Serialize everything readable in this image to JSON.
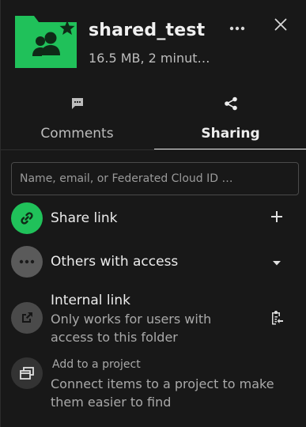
{
  "header": {
    "title": "shared_test",
    "subtitle": "16.5 MB, 2 minut…",
    "folder_icon": "shared-folder-icon",
    "folder_color": "#20c15a",
    "more_icon": "more-horizontal-icon",
    "close_icon": "close-icon"
  },
  "tabs": [
    {
      "label": "Comments",
      "icon": "comment-icon",
      "active": false
    },
    {
      "label": "Sharing",
      "icon": "share-icon",
      "active": true
    }
  ],
  "search": {
    "placeholder": "Name, email, or Federated Cloud ID …",
    "value": ""
  },
  "share_link": {
    "label": "Share link",
    "icon": "link-icon",
    "action_icon": "plus-icon",
    "color": "#20c15a"
  },
  "others": {
    "label": "Others with access",
    "icon": "more-horizontal-icon",
    "action_icon": "caret-down-icon",
    "color": "#5a5a5a"
  },
  "internal_link": {
    "label": "Internal link",
    "description": "Only works for users with access to this folder",
    "icon": "external-link-icon",
    "action_icon": "clipboard-icon",
    "color": "#4a4a4a"
  },
  "project": {
    "label": "Add to a project",
    "description": "Connect items to a project to make them easier to find",
    "icon": "projects-icon",
    "color": "#333333"
  },
  "colors": {
    "background": "#181818",
    "accent": "#20c15a",
    "text": "#e8e8e8",
    "muted": "#a9a9a9"
  }
}
